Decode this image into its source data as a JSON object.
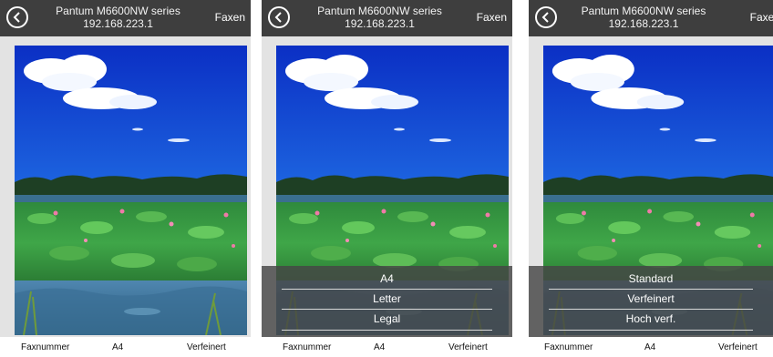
{
  "screens": [
    {
      "header": {
        "title": "Pantum M6600NW series",
        "ip": "192.168.223.1",
        "fax_label": "Faxen"
      },
      "picker": null,
      "bottom": {
        "fax_number": "Faxnummer",
        "paper_size": "A4",
        "resolution": "Verfeinert"
      }
    },
    {
      "header": {
        "title": "Pantum M6600NW series",
        "ip": "192.168.223.1",
        "fax_label": "Faxen"
      },
      "picker": {
        "options": [
          "A4",
          "Letter",
          "Legal"
        ]
      },
      "bottom": {
        "fax_number": "Faxnummer",
        "paper_size": "A4",
        "resolution": "Verfeinert"
      }
    },
    {
      "header": {
        "title": "Pantum M6600NW series",
        "ip": "192.168.223.1",
        "fax_label": "Faxen"
      },
      "picker": {
        "options": [
          "Standard",
          "Verfeinert",
          "Hoch verf."
        ]
      },
      "bottom": {
        "fax_number": "Faxnummer",
        "paper_size": "A4",
        "resolution": "Verfeinert"
      }
    }
  ],
  "icons": {
    "back": "back-arrow-circle-icon"
  },
  "colors": {
    "titlebar": "#3e3e3e",
    "preview_background": "#e3e3e3",
    "picker_overlay": "#464646"
  }
}
